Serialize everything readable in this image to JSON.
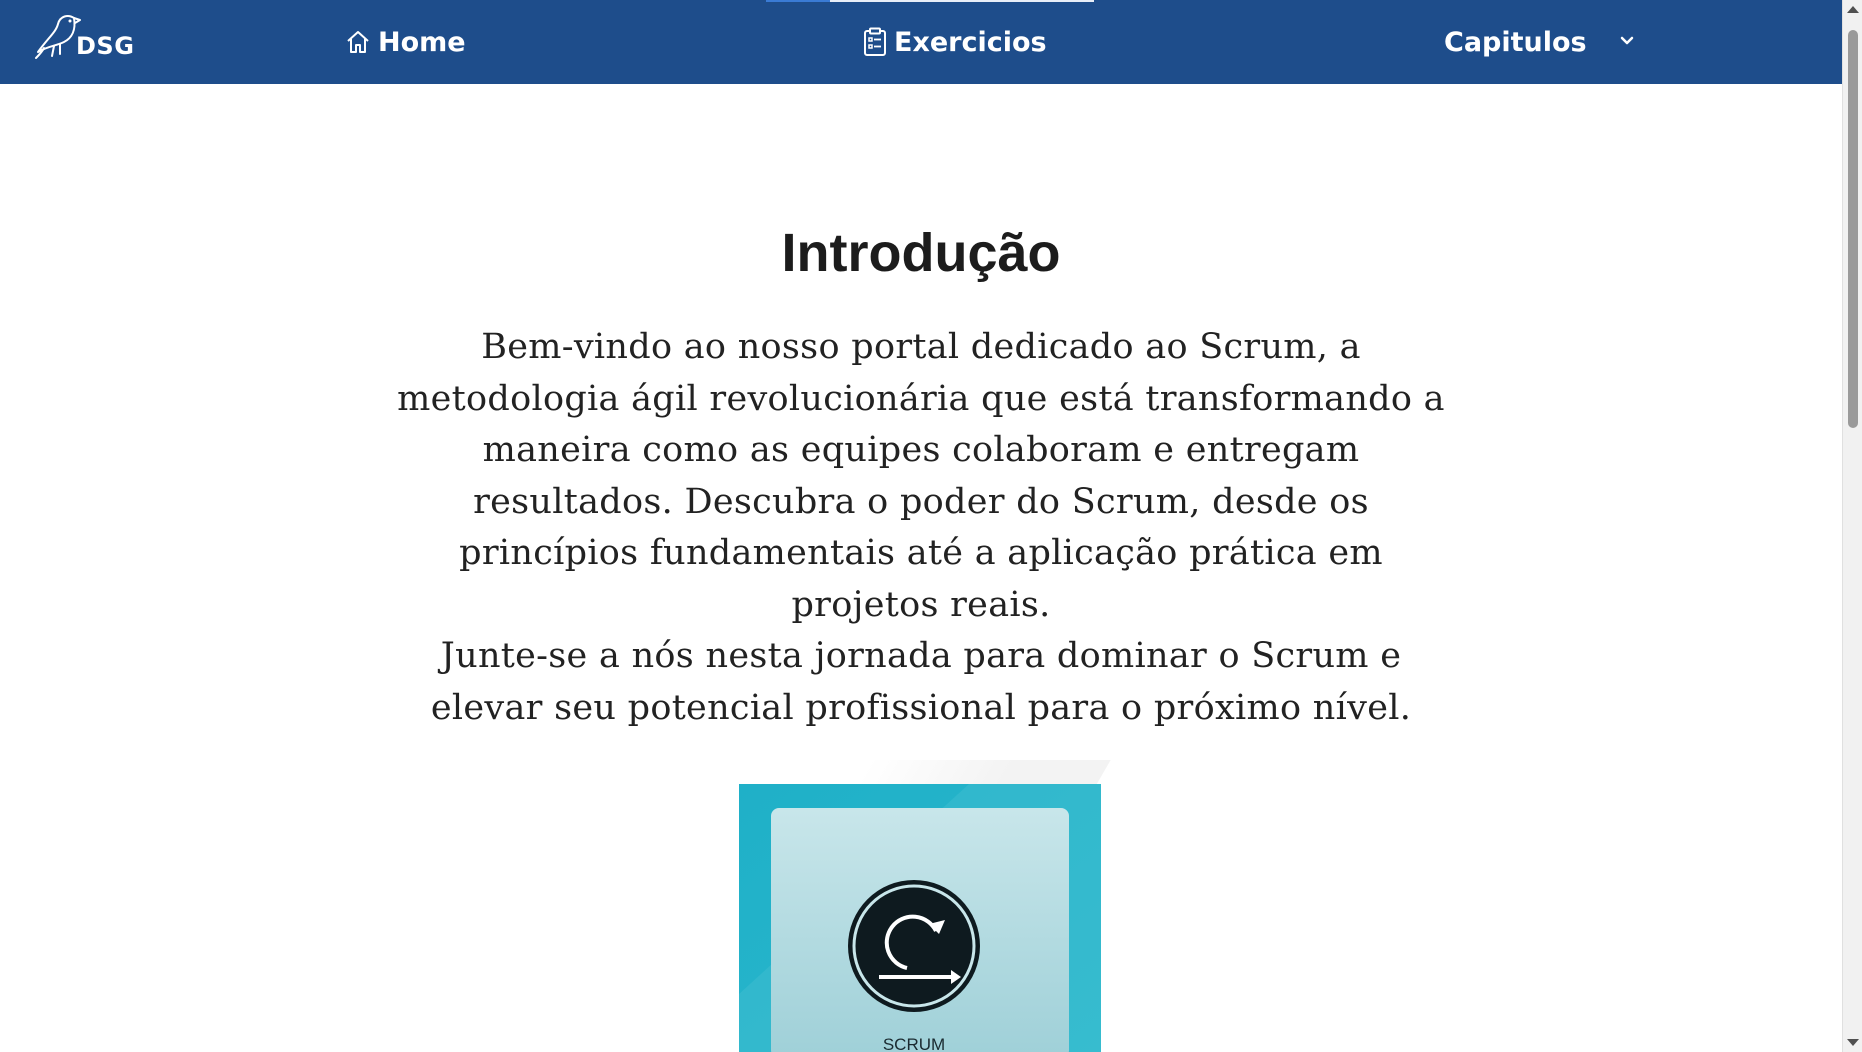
{
  "nav": {
    "logo_text": "DSG",
    "home_label": "Home",
    "exercises_label": "Exercicios",
    "chapters_label": "Capitulos",
    "bg_color": "#1e4d8b"
  },
  "intro": {
    "title": "Introdução",
    "paragraph1": "Bem-vindo ao nosso portal dedicado ao Scrum, a metodologia ágil revolucionária que está transformando a maneira como as equipes colaboram e entregam resultados. Descubra o poder do Scrum, desde os princípios fundamentais até a aplicação prática em projetos reais.",
    "paragraph2": "Junte-se a nós nesta jornada para dominar o Scrum e elevar seu potencial profissional para o próximo nível."
  },
  "cover": {
    "label": "SCRUM"
  },
  "icons": [
    "bird-logo-icon",
    "home-icon",
    "clipboard-icon",
    "chevron-down-icon",
    "scrum-cycle-icon"
  ]
}
